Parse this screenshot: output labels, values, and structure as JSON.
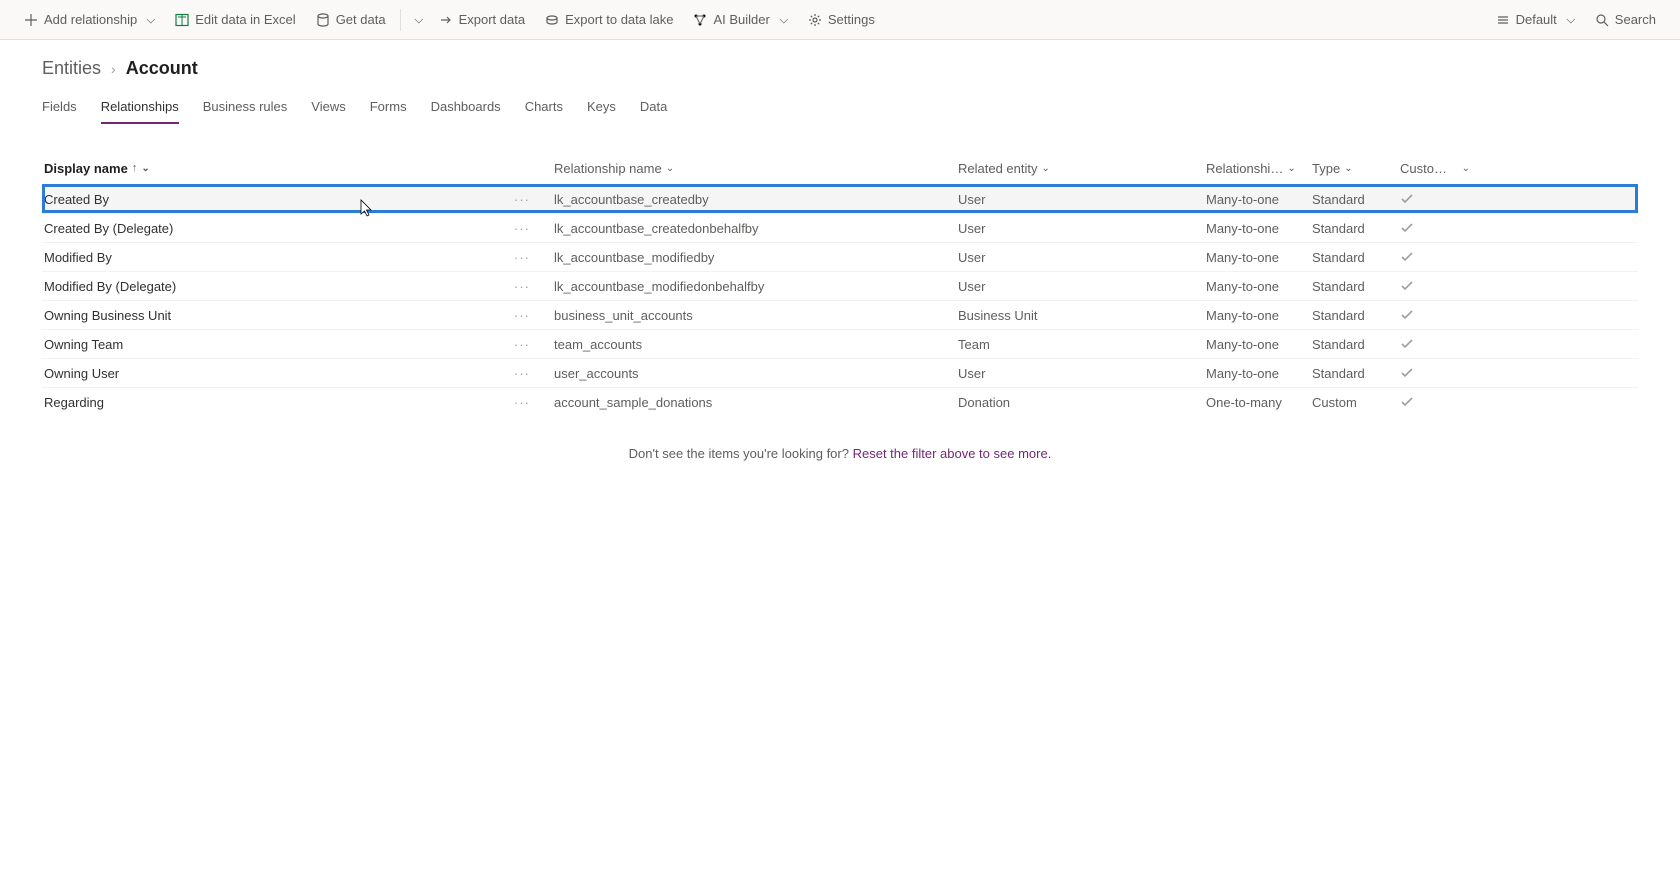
{
  "toolbar": {
    "addRelationship": "Add relationship",
    "editExcel": "Edit data in Excel",
    "getData": "Get data",
    "exportData": "Export data",
    "exportLake": "Export to data lake",
    "aiBuilder": "AI Builder",
    "settings": "Settings",
    "default": "Default",
    "search": "Search"
  },
  "breadcrumb": {
    "parent": "Entities",
    "current": "Account"
  },
  "tabs": [
    "Fields",
    "Relationships",
    "Business rules",
    "Views",
    "Forms",
    "Dashboards",
    "Charts",
    "Keys",
    "Data"
  ],
  "activeTab": "Relationships",
  "columns": {
    "displayName": "Display name",
    "relationshipName": "Relationship name",
    "relatedEntity": "Related entity",
    "relationshipType": "Relationshi…",
    "type": "Type",
    "custom": "Custom…"
  },
  "rows": [
    {
      "displayName": "Created By",
      "relName": "lk_accountbase_createdby",
      "relEntity": "User",
      "relType": "Many-to-one",
      "type": "Standard",
      "custom": true,
      "selected": true
    },
    {
      "displayName": "Created By (Delegate)",
      "relName": "lk_accountbase_createdonbehalfby",
      "relEntity": "User",
      "relType": "Many-to-one",
      "type": "Standard",
      "custom": true
    },
    {
      "displayName": "Modified By",
      "relName": "lk_accountbase_modifiedby",
      "relEntity": "User",
      "relType": "Many-to-one",
      "type": "Standard",
      "custom": true
    },
    {
      "displayName": "Modified By (Delegate)",
      "relName": "lk_accountbase_modifiedonbehalfby",
      "relEntity": "User",
      "relType": "Many-to-one",
      "type": "Standard",
      "custom": true
    },
    {
      "displayName": "Owning Business Unit",
      "relName": "business_unit_accounts",
      "relEntity": "Business Unit",
      "relType": "Many-to-one",
      "type": "Standard",
      "custom": true
    },
    {
      "displayName": "Owning Team",
      "relName": "team_accounts",
      "relEntity": "Team",
      "relType": "Many-to-one",
      "type": "Standard",
      "custom": true
    },
    {
      "displayName": "Owning User",
      "relName": "user_accounts",
      "relEntity": "User",
      "relType": "Many-to-one",
      "type": "Standard",
      "custom": true
    },
    {
      "displayName": "Regarding",
      "relName": "account_sample_donations",
      "relEntity": "Donation",
      "relType": "One-to-many",
      "type": "Custom",
      "custom": true
    }
  ],
  "hint": {
    "pre": "Don't see the items you're looking for? ",
    "link": "Reset the filter above to see more."
  }
}
